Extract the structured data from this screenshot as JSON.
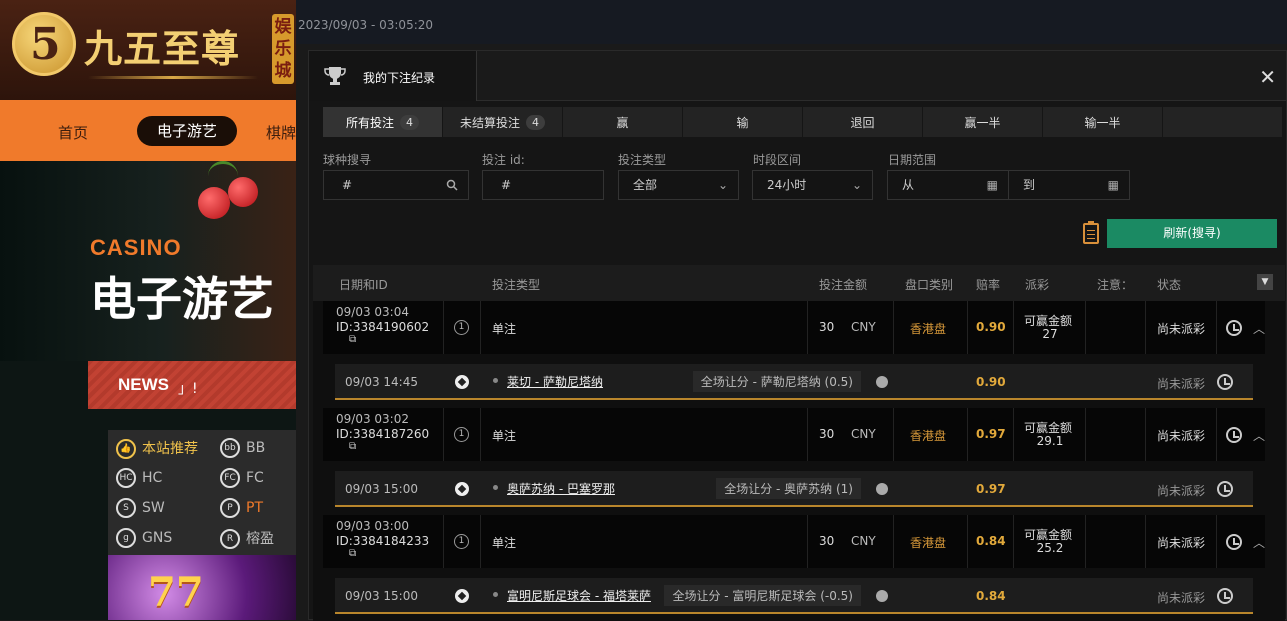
{
  "bg_site": {
    "logo_digit": "5",
    "logo_text": "九五至尊",
    "logo_sub": "娱乐城",
    "nav": {
      "home": "首页",
      "slots": "电子游艺",
      "chess": "棋牌"
    },
    "hero_casino": "CASINO",
    "hero_title": "电子游艺",
    "news_label": "NEWS",
    "news_ticker": "」!",
    "vendors": [
      {
        "icon": "thumbs-up-icon",
        "label": "本站推荐"
      },
      {
        "icon": "bb-logo-icon",
        "label": "BB"
      },
      {
        "icon": "hc-logo-icon",
        "label": "HC"
      },
      {
        "icon": "fc-logo-icon",
        "label": "FC"
      },
      {
        "icon": "sw-logo-icon",
        "label": "SW"
      },
      {
        "icon": "pt-logo-icon",
        "label": "PT"
      },
      {
        "icon": "gns-logo-icon",
        "label": "GNS"
      },
      {
        "icon": "ry-logo-icon",
        "label": "榕盈"
      }
    ],
    "game_art_text": "77"
  },
  "datetime": "2023/09/03 - 03:05:20",
  "modal": {
    "title": "我的下注纪录",
    "close": "✕",
    "tabs": [
      {
        "label": "所有投注",
        "count": "4"
      },
      {
        "label": "未结算投注",
        "count": "4"
      },
      {
        "label": "赢",
        "count": ""
      },
      {
        "label": "输",
        "count": ""
      },
      {
        "label": "退回",
        "count": ""
      },
      {
        "label": "赢一半",
        "count": ""
      },
      {
        "label": "输一半",
        "count": ""
      },
      {
        "label": "",
        "count": ""
      }
    ],
    "filters": {
      "sport_search_label": "球种搜寻",
      "sport_search_placeholder": "#",
      "bet_id_label": "投注 id:",
      "bet_id_placeholder": "#",
      "bet_type_label": "投注类型",
      "bet_type_value": "全部",
      "time_range_label": "时段区间",
      "time_range_value": "24小时",
      "date_range_label": "日期范围",
      "date_from": "从",
      "date_to": "到"
    },
    "refresh_label": "刷新(搜寻)",
    "columns": [
      "日期和ID",
      "投注类型",
      "投注金额",
      "盘口类别",
      "赔率",
      "派彩",
      "注意：",
      "状态"
    ],
    "bets": [
      {
        "datetime": "09/03 03:04",
        "id": "ID:3384190602",
        "num": "1",
        "type": "单注",
        "amount": "30",
        "currency": "CNY",
        "market": "香港盘",
        "odds": "0.90",
        "payout_label": "可赢金额",
        "payout": "27",
        "status": "尚未派彩",
        "sel": {
          "time": "09/03 14:45",
          "match": "莱切 - 萨勒尼塔纳",
          "pick": "全场让分 - 萨勒尼塔纳 (0.5)",
          "odds": "0.90",
          "status": "尚未派彩"
        }
      },
      {
        "datetime": "09/03 03:02",
        "id": "ID:3384187260",
        "num": "1",
        "type": "单注",
        "amount": "30",
        "currency": "CNY",
        "market": "香港盘",
        "odds": "0.97",
        "payout_label": "可赢金额",
        "payout": "29.1",
        "status": "尚未派彩",
        "sel": {
          "time": "09/03 15:00",
          "match": "奥萨苏纳 - 巴塞罗那",
          "pick": "全场让分 - 奥萨苏纳 (1)",
          "odds": "0.97",
          "status": "尚未派彩"
        }
      },
      {
        "datetime": "09/03 03:00",
        "id": "ID:3384184233",
        "num": "1",
        "type": "单注",
        "amount": "30",
        "currency": "CNY",
        "market": "香港盘",
        "odds": "0.84",
        "payout_label": "可赢金额",
        "payout": "25.2",
        "status": "尚未派彩",
        "sel": {
          "time": "09/03 15:00",
          "match": "富明尼斯足球会 - 福塔莱萨",
          "pick": "全场让分 - 富明尼斯足球会 (-0.5)",
          "odds": "0.84",
          "status": "尚未派彩"
        }
      }
    ]
  }
}
